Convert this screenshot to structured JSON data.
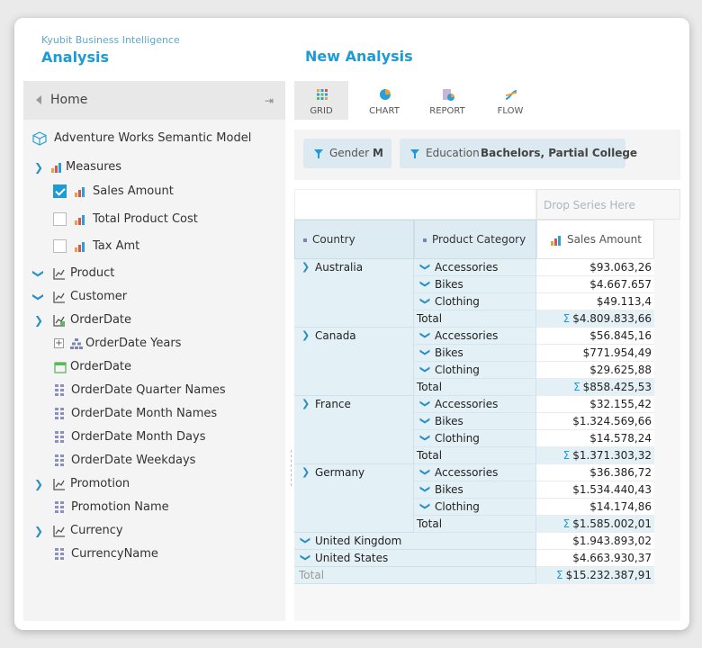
{
  "brand": {
    "subtitle": "Kyubit Business Intelligence",
    "title": "Analysis"
  },
  "analysis_title": "New Analysis",
  "sidebar": {
    "home_label": "Home",
    "model_label": "Adventure Works Semantic Model",
    "items": [
      {
        "label": "Measures"
      },
      {
        "label": "Sales Amount",
        "checked": true
      },
      {
        "label": "Total Product Cost",
        "checked": false
      },
      {
        "label": "Tax Amt",
        "checked": false
      },
      {
        "label": "Product"
      },
      {
        "label": "Customer"
      },
      {
        "label": "OrderDate"
      },
      {
        "label": "OrderDate Years"
      },
      {
        "label": "OrderDate"
      },
      {
        "label": "OrderDate Quarter Names"
      },
      {
        "label": "OrderDate Month Names"
      },
      {
        "label": "OrderDate Month Days"
      },
      {
        "label": "OrderDate Weekdays"
      },
      {
        "label": "Promotion"
      },
      {
        "label": "Promotion Name"
      },
      {
        "label": "Currency"
      },
      {
        "label": "CurrencyName"
      }
    ]
  },
  "toolbar": {
    "grid": "GRID",
    "chart": "CHART",
    "report": "REPORT",
    "flow": "FLOW"
  },
  "filters": [
    {
      "name": "Gender",
      "value": "M"
    },
    {
      "name": "Education",
      "value": "Bachelors, Partial College"
    }
  ],
  "pivot": {
    "drop_series": "Drop Series Here",
    "headers": {
      "row1": "Country",
      "row2": "Product Category",
      "measure": "Sales Amount"
    },
    "total_label": "Total",
    "groups": [
      {
        "country": "Australia",
        "rows": [
          {
            "cat": "Accessories",
            "val": "$93.063,26"
          },
          {
            "cat": "Bikes",
            "val": "$4.667.657"
          },
          {
            "cat": "Clothing",
            "val": "$49.113,4"
          }
        ],
        "total": "$4.809.833,66"
      },
      {
        "country": "Canada",
        "rows": [
          {
            "cat": "Accessories",
            "val": "$56.845,16"
          },
          {
            "cat": "Bikes",
            "val": "$771.954,49"
          },
          {
            "cat": "Clothing",
            "val": "$29.625,88"
          }
        ],
        "total": "$858.425,53"
      },
      {
        "country": "France",
        "rows": [
          {
            "cat": "Accessories",
            "val": "$32.155,42"
          },
          {
            "cat": "Bikes",
            "val": "$1.324.569,66"
          },
          {
            "cat": "Clothing",
            "val": "$14.578,24"
          }
        ],
        "total": "$1.371.303,32"
      },
      {
        "country": "Germany",
        "rows": [
          {
            "cat": "Accessories",
            "val": "$36.386,72"
          },
          {
            "cat": "Bikes",
            "val": "$1.534.440,43"
          },
          {
            "cat": "Clothing",
            "val": "$14.174,86"
          }
        ],
        "total": "$1.585.002,01"
      }
    ],
    "collapsed": [
      {
        "country": "United Kingdom",
        "val": "$1.943.893,02"
      },
      {
        "country": "United States",
        "val": "$4.663.930,37"
      }
    ],
    "grand_total_label": "Total",
    "grand_total": "$15.232.387,91",
    "sigma": "Σ"
  }
}
